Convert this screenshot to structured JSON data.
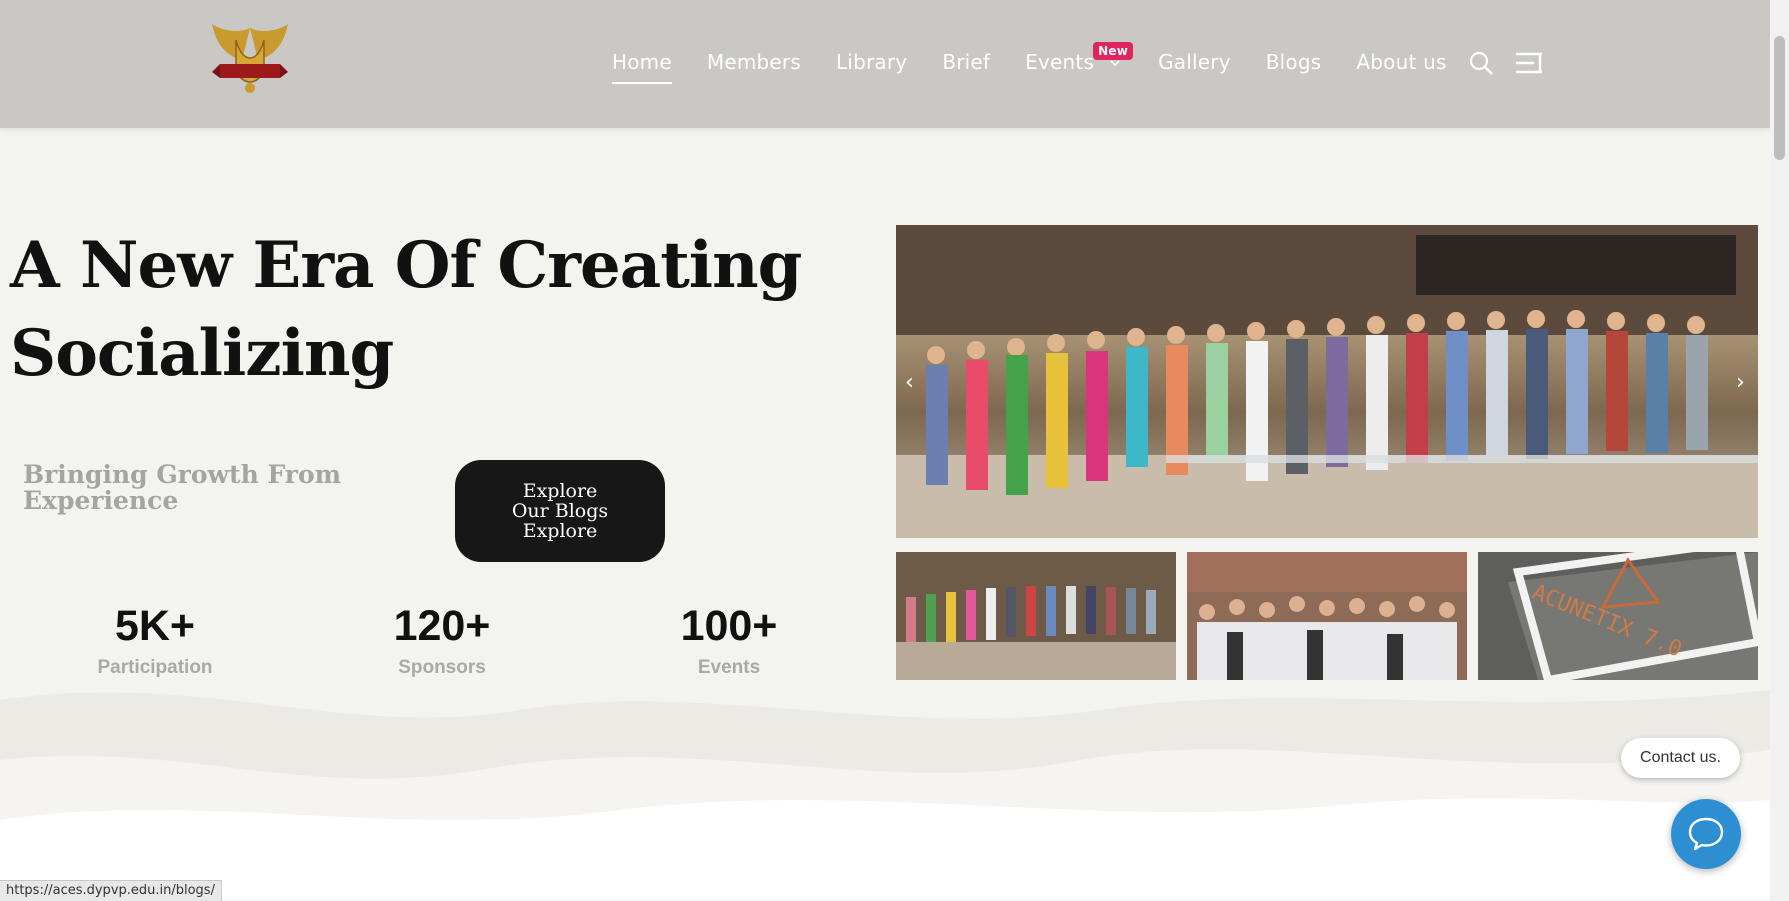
{
  "nav": {
    "items": [
      {
        "label": "Home"
      },
      {
        "label": "Members"
      },
      {
        "label": "Library"
      },
      {
        "label": "Brief"
      },
      {
        "label": "Events"
      },
      {
        "label": "Gallery"
      },
      {
        "label": "Blogs"
      },
      {
        "label": "About us"
      }
    ],
    "events_badge": "New",
    "active": "Home"
  },
  "hero": {
    "title_line1": "A New Era Of Creating",
    "title_line2": "Socializing",
    "subtitle": "Bringing Growth From Experience",
    "cta_lines": [
      "Explore",
      "Our Blogs",
      "Explore"
    ]
  },
  "stats": [
    {
      "value": "5K+",
      "label": "Participation"
    },
    {
      "value": "120+",
      "label": "Sponsors"
    },
    {
      "value": "100+",
      "label": "Events"
    }
  ],
  "gallery": {
    "thumb3_text": "ACUNETIX 7.0"
  },
  "widgets": {
    "contact_label": "Contact us."
  },
  "status_bar": {
    "url": "https://aces.dypvp.edu.in/blogs/"
  },
  "colors": {
    "header_bg": "#c9c8c5",
    "page_bg": "#f3f3ef",
    "badge": "#e0245e",
    "cta_bg": "#171717",
    "chat_blue": "#2d8fd2"
  },
  "icons": [
    "logo-emblem",
    "chevron-down-icon",
    "search-icon",
    "sidebar-toggle-icon",
    "chat-bubble-icon",
    "chevron-left-icon",
    "chevron-right-icon"
  ]
}
